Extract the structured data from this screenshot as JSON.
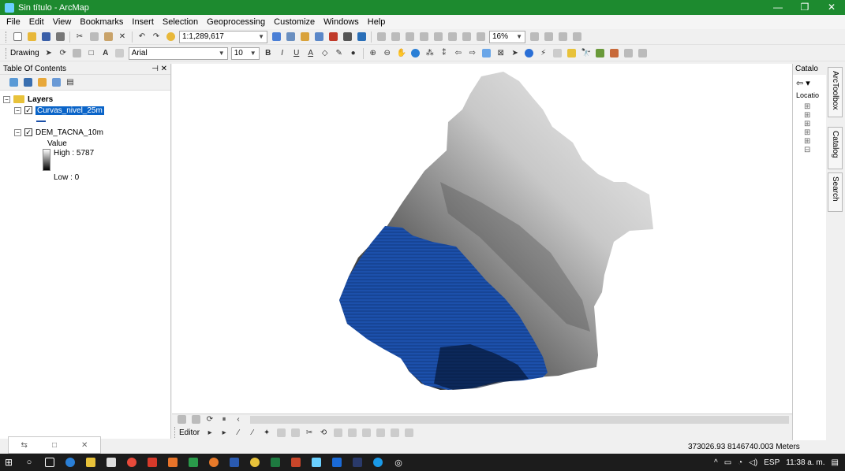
{
  "window": {
    "title": "Sin título - ArcMap",
    "minimize": "—",
    "maximize": "❐",
    "close": "✕"
  },
  "menu": [
    "File",
    "Edit",
    "View",
    "Bookmarks",
    "Insert",
    "Selection",
    "Geoprocessing",
    "Customize",
    "Windows",
    "Help"
  ],
  "standard_toolbar": {
    "scale": "1:1,289,617",
    "zoom": "16%"
  },
  "draw_toolbar": {
    "drawing_label": "Drawing",
    "font": "Arial",
    "font_size": "10",
    "bold": "B",
    "italic": "I",
    "underline": "U",
    "text_a": "A"
  },
  "toc": {
    "title": "Table Of Contents",
    "layers_group": "Layers",
    "layer1": "Curvas_nivel_25m",
    "layer2": "DEM_TACNA_10m",
    "legend_value": "Value",
    "legend_high": "High : 5787",
    "legend_low": "Low : 0",
    "colors": {
      "selection": "#0a64c8"
    }
  },
  "map": {
    "contour_color": "#1a4fa8",
    "dem_high": "#ffffff",
    "dem_low": "#000000"
  },
  "editor": {
    "label": "Editor"
  },
  "catalog": {
    "title": "Catalo",
    "location": "Locatio"
  },
  "side_tabs": [
    "ArcToolbox",
    "Catalog",
    "Search"
  ],
  "status": {
    "coords": "373026.93  8146740.003 Meters"
  },
  "tray": {
    "lang": "ESP",
    "time": "11:38 a. m."
  }
}
